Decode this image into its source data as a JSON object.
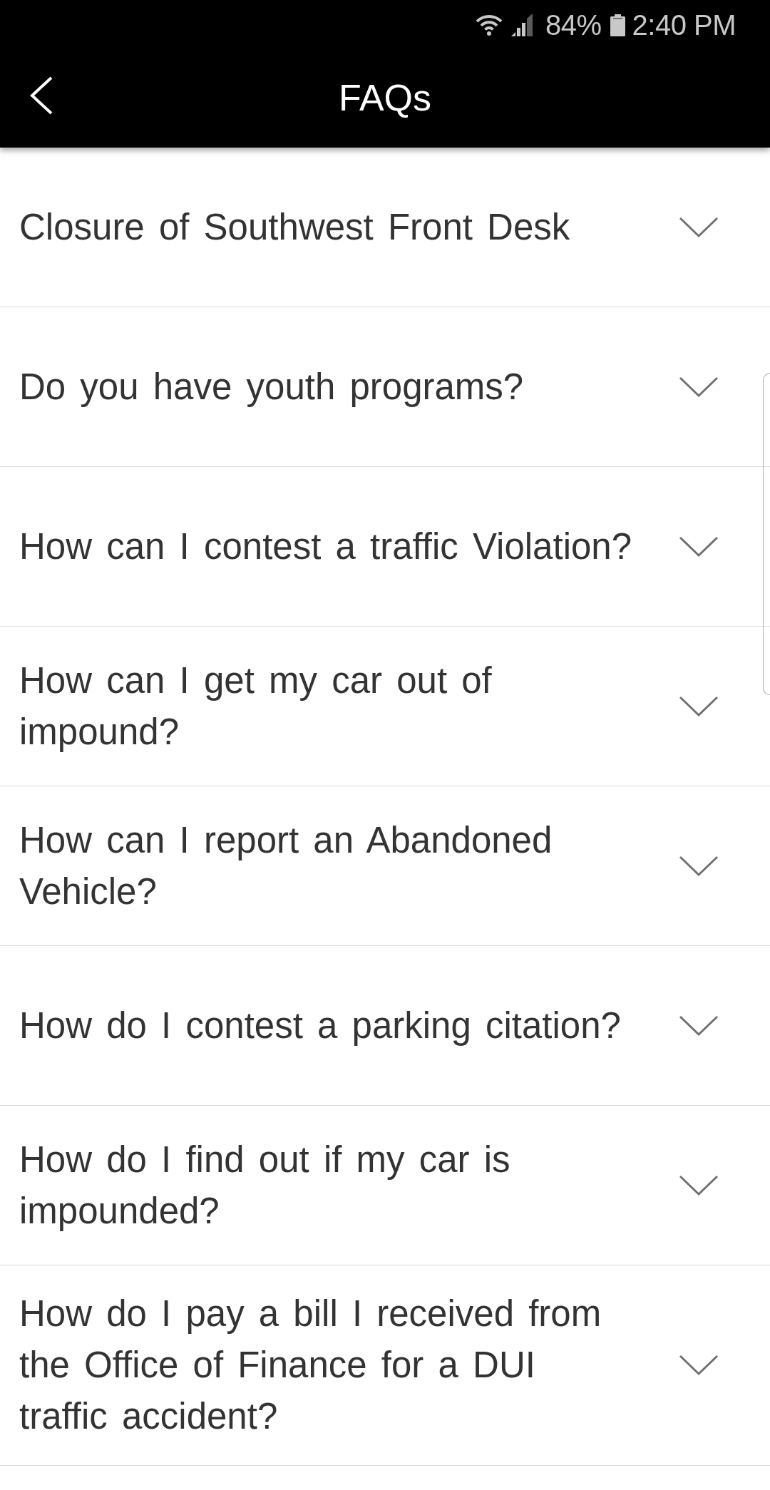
{
  "status_bar": {
    "battery": "84%",
    "time": "2:40 PM"
  },
  "header": {
    "title": "FAQs"
  },
  "faqs": [
    {
      "question": "Closure of Southwest Front Desk",
      "expanded": false
    },
    {
      "question": "Do you have youth programs?",
      "expanded": false
    },
    {
      "question": "How can I contest a traffic Violation?",
      "expanded": false
    },
    {
      "question": "How can I get my car out of impound?",
      "expanded": false
    },
    {
      "question": "How can I report an Abandoned Vehicle?",
      "expanded": false
    },
    {
      "question": "How do I contest a parking citation?",
      "expanded": false
    },
    {
      "question": "How do I find out if my car is impounded?",
      "expanded": false
    },
    {
      "question": "How do I pay a bill I received from the Office of Finance for a DUI traffic accident?",
      "expanded": false
    }
  ]
}
